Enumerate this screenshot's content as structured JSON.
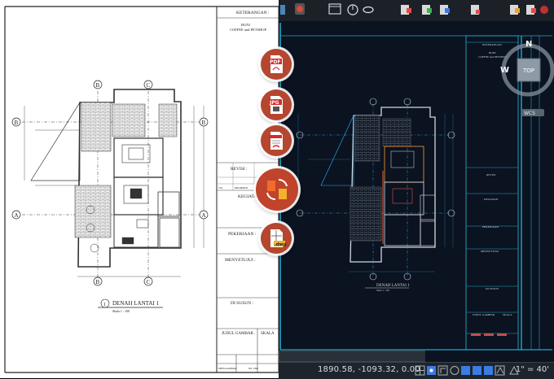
{
  "paper": {
    "keterangan": "KETERANGAN :",
    "project_line1": "BUNI",
    "project_line2": "COFFEE and PETSHOP",
    "revisi": "REVISI :",
    "kegiatan": "KEGIATAN :",
    "pekerjaan": "PEKERJAAN :",
    "menyetujui": "MENYETUJUI :",
    "di_susun": "DI SUSUN :",
    "judul_gambar": "JUDUL GAMBAR :",
    "skala": "SKALA",
    "tgl": "TGL",
    "dikoreksi": "DIKOREKSI",
    "no_lbr": "NO. LBR",
    "menggambar": "MENGGAMBAR",
    "plan_title": "DENAH LANTAI 1",
    "plan_scale": "Skala 1 : 100",
    "grid_b": "B",
    "grid_c": "C",
    "grid_a": "A",
    "grid_1": "1"
  },
  "cad": {
    "plan_title": "DENAH LANTAI 1",
    "plan_scale": "Skala 1 : 100",
    "keterangan": "KETERANGAN",
    "project_line1": "BUNI",
    "project_line2": "COFFEE and PETSHOP",
    "revisi": "REVISI",
    "kegiatan": "KEGIATAN",
    "pekerjaan": "PEKERJAAN",
    "menyetujui": "MENYETUJUI",
    "disusun": "DI SUSUN",
    "judul": "JUDUL GAMBAR",
    "skala": "SKALA"
  },
  "format_icons": [
    {
      "label": "PDF",
      "icon": "pdf-file-icon"
    },
    {
      "label": "JPG",
      "icon": "jpg-file-icon"
    },
    {
      "label": "",
      "icon": "pdf-signature-icon"
    },
    {
      "label": "",
      "icon": "convert-swap-icon"
    },
    {
      "label": ".dwg",
      "icon": "dwg-file-icon"
    }
  ],
  "viewcube": {
    "north": "N",
    "west": "W",
    "face": "TOP",
    "wcs": "WCS"
  },
  "status": {
    "coordinates": "1890.58, -1093.32, 0.00",
    "scale": "1\" = 40'"
  },
  "colors": {
    "cad_bg": "#0b1220",
    "cad_cyan": "#1fa9c9",
    "accent": "#c0432c"
  }
}
